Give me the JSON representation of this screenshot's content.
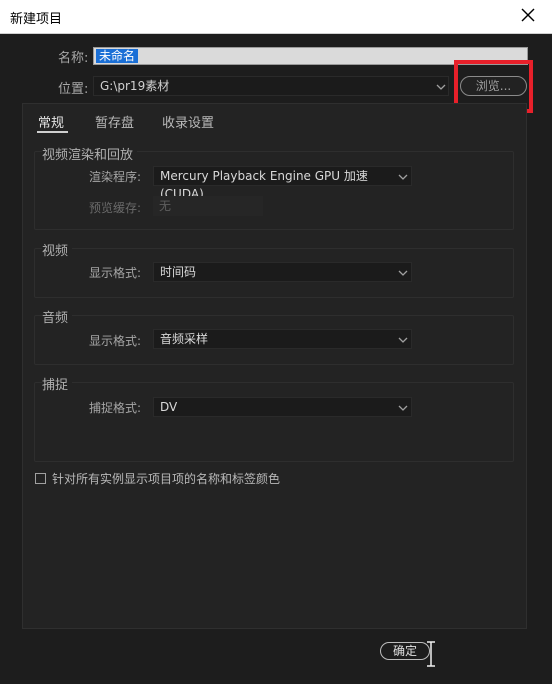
{
  "window": {
    "title": "新建项目"
  },
  "project": {
    "name_label": "名称:",
    "name_value": "未命名",
    "location_label": "位置:",
    "location_value": "G:\\pr19素材",
    "browse_label": "浏览..."
  },
  "tabs": [
    {
      "label": "常规",
      "active": true
    },
    {
      "label": "暂存盘",
      "active": false
    },
    {
      "label": "收录设置",
      "active": false
    }
  ],
  "sections": {
    "render": {
      "title": "视频渲染和回放",
      "renderer_label": "渲染程序:",
      "renderer_value": "Mercury Playback Engine GPU 加速 (CUDA)",
      "preview_cache_label": "预览缓存:",
      "preview_cache_value": "无"
    },
    "video": {
      "title": "视频",
      "display_format_label": "显示格式:",
      "display_format_value": "时间码"
    },
    "audio": {
      "title": "音频",
      "display_format_label": "显示格式:",
      "display_format_value": "音频采样"
    },
    "capture": {
      "title": "捕捉",
      "capture_format_label": "捕捉格式:",
      "capture_format_value": "DV"
    }
  },
  "options": {
    "show_names_colors_label": "针对所有实例显示项目项的名称和标签颜色",
    "show_names_colors_checked": false
  },
  "footer": {
    "ok_label": "确定"
  },
  "colors": {
    "highlight": "#e8202a",
    "selection": "#1a6fd6",
    "background": "#1d1d1d"
  }
}
